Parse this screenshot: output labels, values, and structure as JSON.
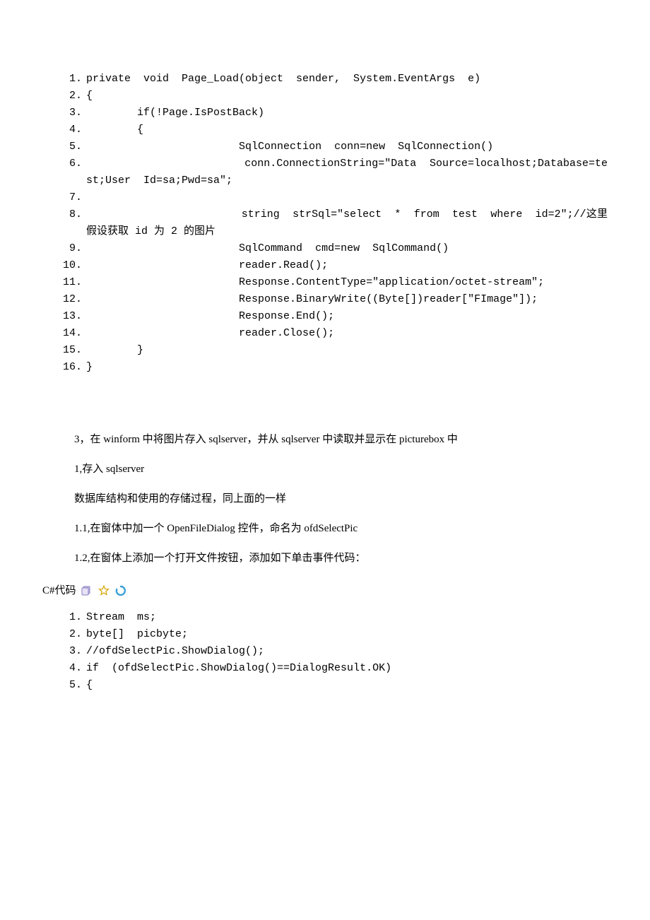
{
  "codeBlock1": {
    "lines": [
      {
        "n": "1.",
        "body": "private  void  Page_Load(object  sender,  System.EventArgs  e)  "
      },
      {
        "n": "2.",
        "body": "{  "
      },
      {
        "n": "3.",
        "body": "        if(!Page.IsPostBack)  "
      },
      {
        "n": "4.",
        "body": "        {  "
      },
      {
        "n": "5.",
        "body": "                        SqlConnection  conn=new  SqlConnection()  "
      },
      {
        "n": "6.",
        "body": "                        conn.ConnectionString=\"Data  Source=localhost;Database=test;User  Id=sa;Pwd=sa\";  "
      },
      {
        "n": "7.",
        "body": "  "
      },
      {
        "n": "8.",
        "body": "                        string  strSql=\"select  *  from  test  where  id=2\";//这里假设获取 id 为 2 的图片  "
      },
      {
        "n": "9.",
        "body": "                        SqlCommand  cmd=new  SqlCommand()  "
      },
      {
        "n": "10.",
        "body": "                        reader.Read();  "
      },
      {
        "n": "11.",
        "body": "                        Response.ContentType=\"application/octet-stream\";  "
      },
      {
        "n": "12.",
        "body": "                        Response.BinaryWrite((Byte[])reader[\"FImage\"]);  "
      },
      {
        "n": "13.",
        "body": "                        Response.End();  "
      },
      {
        "n": "14.",
        "body": "                        reader.Close();  "
      },
      {
        "n": "15.",
        "body": "        }  "
      },
      {
        "n": "16.",
        "body": "}  "
      }
    ]
  },
  "paragraphs": {
    "p1": "3，在 winform 中将图片存入 sqlserver，并从 sqlserver 中读取并显示在 picturebox 中",
    "p2": "1,存入 sqlserver",
    "p3": "数据库结构和使用的存储过程，同上面的一样",
    "p4": "1.1,在窗体中加一个 OpenFileDialog 控件，命名为 ofdSelectPic",
    "p5": "1.2,在窗体上添加一个打开文件按钮，添加如下单击事件代码："
  },
  "labelRow": {
    "text": "C#代码"
  },
  "codeBlock2": {
    "lines": [
      {
        "n": "1.",
        "body": "Stream  ms;  "
      },
      {
        "n": "2.",
        "body": "byte[]  picbyte;  "
      },
      {
        "n": "3.",
        "body": "//ofdSelectPic.ShowDialog();  "
      },
      {
        "n": "4.",
        "body": "if  (ofdSelectPic.ShowDialog()==DialogResult.OK)  "
      },
      {
        "n": "5.",
        "body": "{  "
      }
    ]
  }
}
